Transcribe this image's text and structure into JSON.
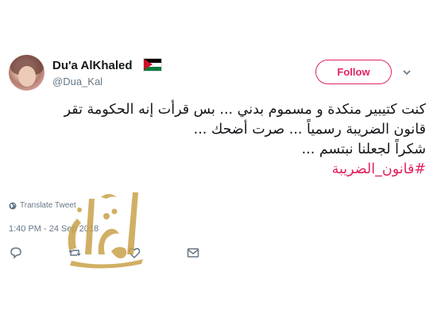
{
  "user": {
    "name": "Du'a AlKhaled",
    "handle": "@Dua_Kal",
    "flag_icon": "jordan-flag-icon"
  },
  "follow_button": {
    "label": "Follow",
    "color": "#e0245e"
  },
  "menu": {
    "icon": "chevron-down-icon"
  },
  "tweet": {
    "lines": [
      "كنت كتيبير منكدة و مسموم بدني ... بس قرأت إنه الحكومة تقر",
      "قانون الضريبة رسمياً ... صرت أضحك ...",
      "شكراً لجعلنا نبتسم ..."
    ],
    "hashtag": "#قانون_الضريبة"
  },
  "translate": {
    "label": "Translate Tweet",
    "icon": "globe-icon"
  },
  "timestamp": "1:40 PM - 24 Sep 2018",
  "actions": [
    {
      "name": "reply-icon"
    },
    {
      "name": "retweet-icon"
    },
    {
      "name": "like-icon"
    },
    {
      "name": "message-icon"
    }
  ],
  "watermark": {
    "text": "الوكيل",
    "color": "#c9a24a"
  },
  "colors": {
    "text": "#14171a",
    "secondary": "#657786",
    "accent": "#e0245e"
  }
}
